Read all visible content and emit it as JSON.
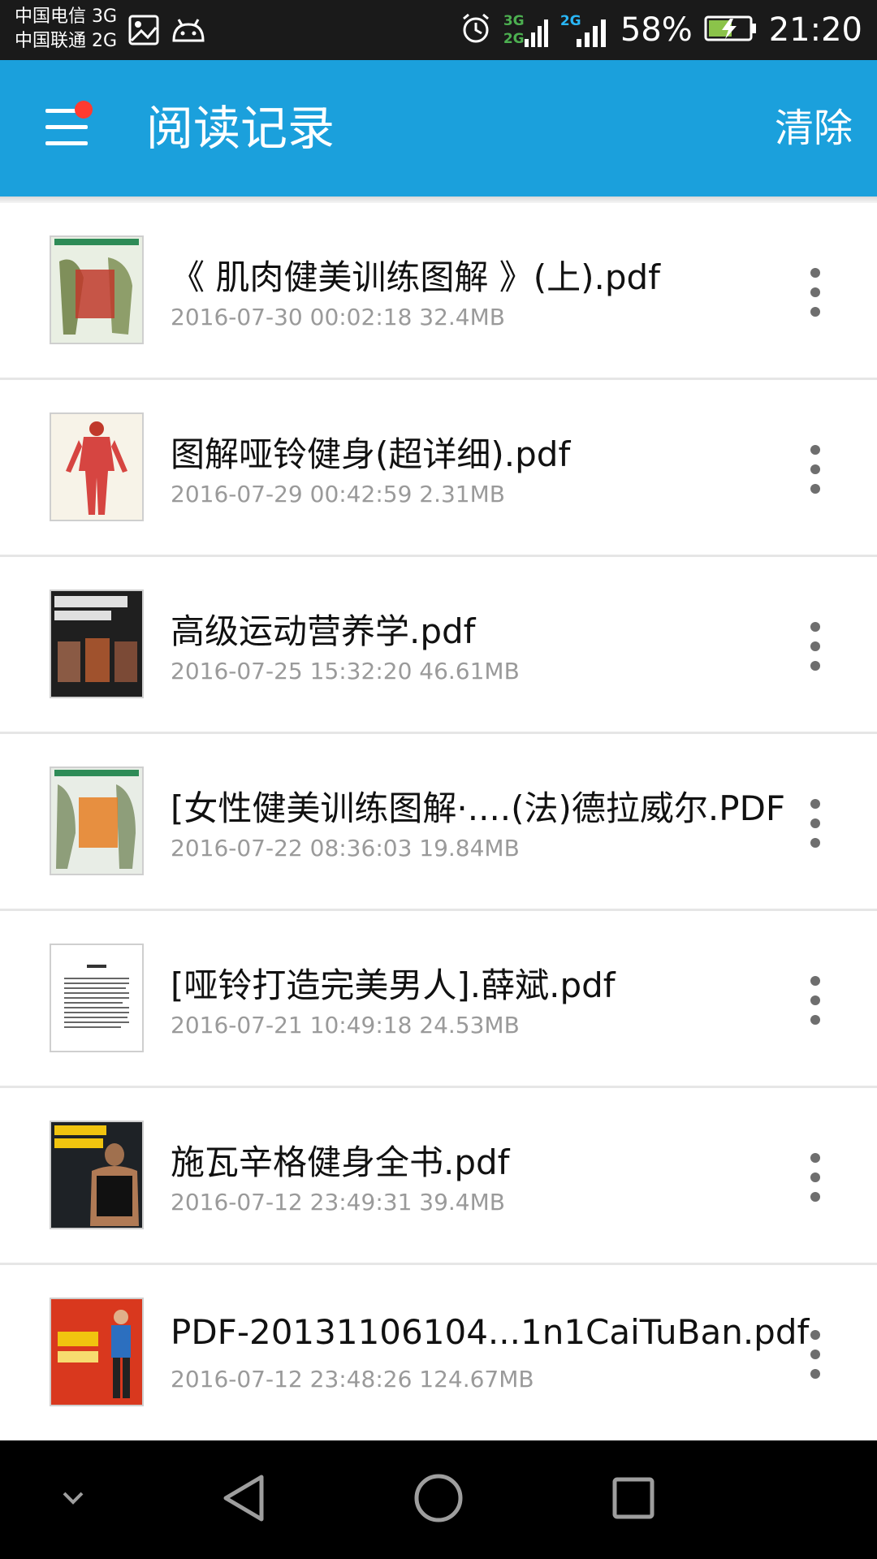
{
  "status_bar": {
    "carrier_1": "中国电信 3G",
    "carrier_2": "中国联通 2G",
    "sig_1_top": "3G",
    "sig_1_bottom": "2G",
    "sig_2_top": "2G",
    "battery": "58%",
    "time": "21:20"
  },
  "app_bar": {
    "title": "阅读记录",
    "clear_label": "清除",
    "color": "#1ba0dc"
  },
  "history": [
    {
      "title": "《 肌肉健美训练图解 》(上).pdf",
      "meta": "2016-07-30 00:02:18 32.4MB"
    },
    {
      "title": "图解哑铃健身(超详细).pdf",
      "meta": "2016-07-29 00:42:59 2.31MB"
    },
    {
      "title": "高级运动营养学.pdf",
      "meta": "2016-07-25 15:32:20 46.61MB"
    },
    {
      "title": "[女性健美训练图解·....(法)德拉威尔.PDF",
      "meta": "2016-07-22 08:36:03 19.84MB"
    },
    {
      "title": "[哑铃打造完美男人].薛斌.pdf",
      "meta": "2016-07-21 10:49:18 24.53MB"
    },
    {
      "title": "施瓦辛格健身全书.pdf",
      "meta": "2016-07-12 23:49:31 39.4MB"
    },
    {
      "title": "PDF-20131106104...1n1CaiTuBan.pdf",
      "meta": "2016-07-12 23:48:26 124.67MB"
    }
  ]
}
